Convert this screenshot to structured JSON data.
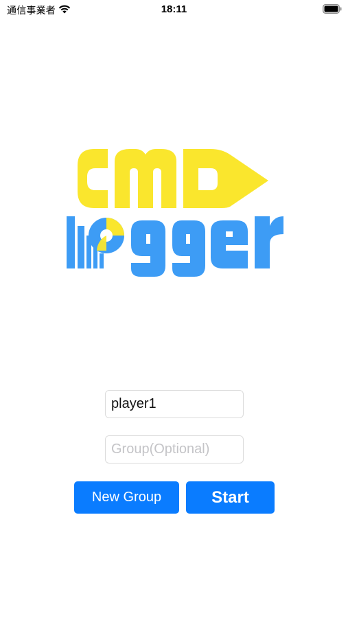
{
  "status_bar": {
    "carrier": "通信事業者",
    "time": "18:11",
    "wifi_icon": "wifi-icon",
    "battery_icon": "battery-full-icon"
  },
  "logo": {
    "text": "CMD logger",
    "colors": {
      "yellow": "#fae62d",
      "blue": "#3d9cf5"
    }
  },
  "form": {
    "player_value": "player1",
    "group_value": "",
    "group_placeholder": "Group(Optional)",
    "new_group_label": "New Group",
    "start_label": "Start"
  },
  "colors": {
    "accent": "#0a7cff"
  }
}
